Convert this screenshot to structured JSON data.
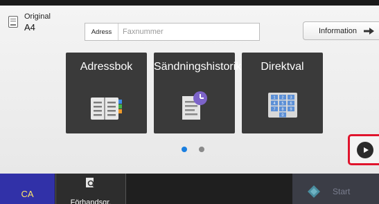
{
  "original": {
    "label": "Original",
    "value": "A4",
    "icon": "original-doc-icon"
  },
  "address": {
    "button_label": "Adress",
    "placeholder": "Faxnummer"
  },
  "info_button": {
    "label": "Information",
    "icon": "arrow-right-icon"
  },
  "tiles": [
    {
      "label": "Adressbok",
      "icon": "address-book-icon"
    },
    {
      "label": "Sändningshistorik",
      "icon": "send-history-icon"
    },
    {
      "label": "Direktval",
      "icon": "keypad-icon"
    }
  ],
  "keypad_digits": [
    "1",
    "2",
    "3",
    "4",
    "5",
    "6",
    "7",
    "8",
    "9",
    "0"
  ],
  "pager": {
    "pages": 2,
    "active": 1
  },
  "next_button": {
    "icon": "play-icon"
  },
  "bottom_bar": {
    "ca_label": "CA",
    "preview_label": "Förhandsgr.",
    "preview_icon": "preview-magnifier-icon",
    "start_label": "Start",
    "start_icon": "start-diamond-icon"
  },
  "colors": {
    "accent_blue": "#1a7fe0",
    "highlight_red": "#e0142d",
    "ca_blue": "#3131a8",
    "ca_text": "#ffe66a",
    "tile_bg": "#3a3a3a"
  }
}
